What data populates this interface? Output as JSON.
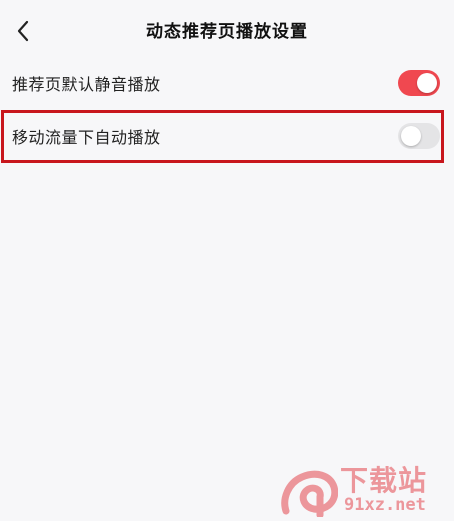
{
  "header": {
    "title": "动态推荐页播放设置",
    "back_icon": "chevron-left-icon"
  },
  "settings": [
    {
      "label": "推荐页默认静音播放",
      "enabled": true
    },
    {
      "label": "移动流量下自动播放",
      "enabled": false
    }
  ],
  "colors": {
    "toggle_on": "#f04850",
    "toggle_off": "#e4e4e6",
    "highlight_border": "#c8161d",
    "background": "#f7f7f9"
  },
  "watermark": {
    "text": "下载站",
    "domain": "91xz.net",
    "logo_text": "9"
  }
}
